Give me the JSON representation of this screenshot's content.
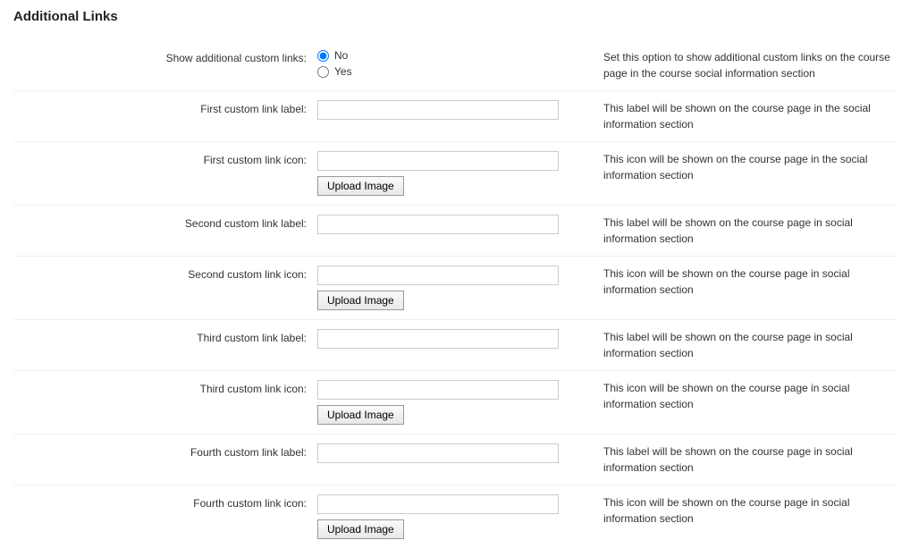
{
  "section_title": "Additional Links",
  "rows": {
    "show_links": {
      "label": "Show additional custom links:",
      "option_no": "No",
      "option_yes": "Yes",
      "desc": "Set this option to show additional custom links on the course page in the course social information section"
    },
    "first_label": {
      "label": "First custom link label:",
      "desc": "This label will be shown on the course page in the social information section"
    },
    "first_icon": {
      "label": "First custom link icon:",
      "upload": "Upload Image",
      "desc": "This icon will be shown on the course page in the social information section"
    },
    "second_label": {
      "label": "Second custom link label:",
      "desc": "This label will be shown on the course page in social information section"
    },
    "second_icon": {
      "label": "Second custom link icon:",
      "upload": "Upload Image",
      "desc": "This icon will be shown on the course page in social information section"
    },
    "third_label": {
      "label": "Third custom link label:",
      "desc": "This label will be shown on the course page in social information section"
    },
    "third_icon": {
      "label": "Third custom link icon:",
      "upload": "Upload Image",
      "desc": "This icon will be shown on the course page in social information section"
    },
    "fourth_label": {
      "label": "Fourth custom link label:",
      "desc": "This label will be shown on the course page in social information section"
    },
    "fourth_icon": {
      "label": "Fourth custom link icon:",
      "upload": "Upload Image",
      "desc": "This icon will be shown on the course page in social information section"
    }
  }
}
